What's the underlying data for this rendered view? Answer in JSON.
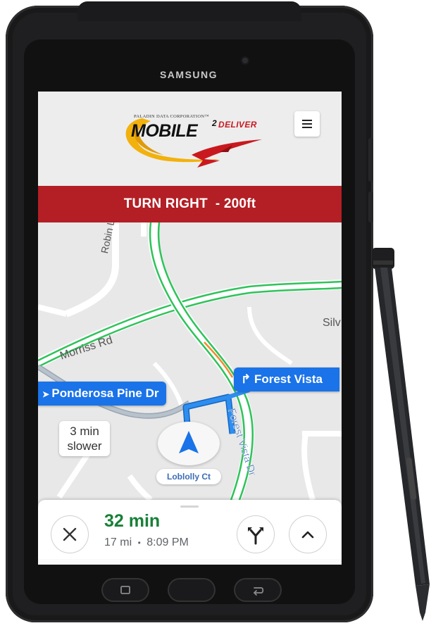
{
  "device": {
    "brand": "SAMSUNG"
  },
  "app": {
    "logo": {
      "small_text": "PALADIN DATA CORPORATION™",
      "main_text": "MOBILE",
      "superscript": "2",
      "accent_text": "DELIVER"
    },
    "menu_icon": "hamburger-icon"
  },
  "navigation": {
    "instruction": "TURN RIGHT  - 200ft"
  },
  "map": {
    "street_labels": [
      "Robin Ln",
      "Morriss Rd",
      "Silv",
      "Forest Vista Dr"
    ],
    "next_turn_chip": {
      "icon": "turn-right-arrow-icon",
      "label": "Forest Vista"
    },
    "alt_route_chip": {
      "icon": "turn-arrow-icon",
      "label": "Ponderosa Pine Dr"
    },
    "alt_route_delay": {
      "line1": "3 min",
      "line2": "slower"
    },
    "current_street": "Loblolly Ct",
    "route_color": "#1a73e8",
    "traffic_green": "#2ec35a",
    "traffic_orange": "#f28b30"
  },
  "trip": {
    "duration": "32 min",
    "distance": "17 mi",
    "separator": "•",
    "arrival": "8:09 PM",
    "close_icon": "close-icon",
    "routes_icon": "alternate-routes-icon",
    "expand_icon": "chevron-up-icon"
  },
  "colors": {
    "banner": "#b31f25",
    "eta_green": "#188038",
    "logo_red": "#c9191f",
    "logo_gold": "#f2b10c"
  }
}
